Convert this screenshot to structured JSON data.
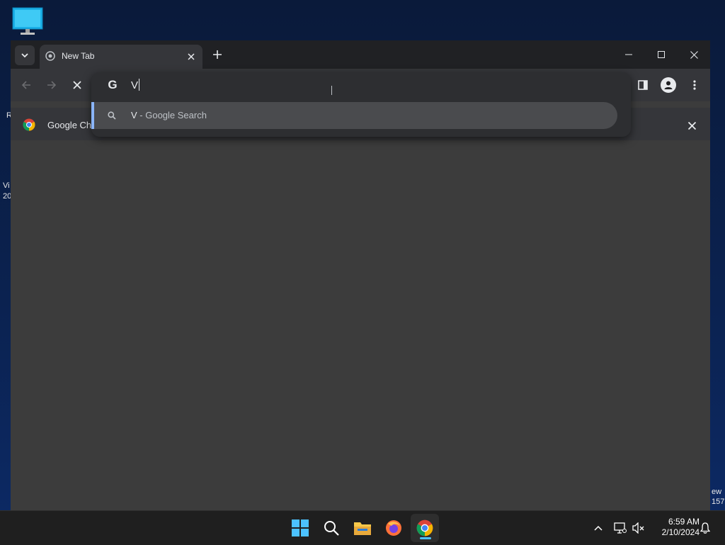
{
  "desktop": {
    "icon": "this-pc-monitor-icon",
    "left_edge_fragments": [
      "R",
      "Vi",
      "20"
    ],
    "right_edge_fragments": [
      "ew",
      "157"
    ]
  },
  "browser": {
    "tab": {
      "title": "New Tab",
      "icon": "chrome-favicon"
    },
    "address_input_value": "V",
    "omnibox_suggestion": {
      "query": "V",
      "suffix": " - Google Search"
    },
    "infobar_text": "Google Ch",
    "colors": {
      "accent": "#8ab4f8",
      "frame": "#202124",
      "toolbar": "#35363a"
    }
  },
  "taskbar": {
    "time": "6:59 AM",
    "date": "2/10/2024",
    "apps": [
      "start",
      "search",
      "file-explorer",
      "firefox",
      "chrome"
    ],
    "colors": {
      "active_indicator": "#4cc2ff"
    }
  }
}
